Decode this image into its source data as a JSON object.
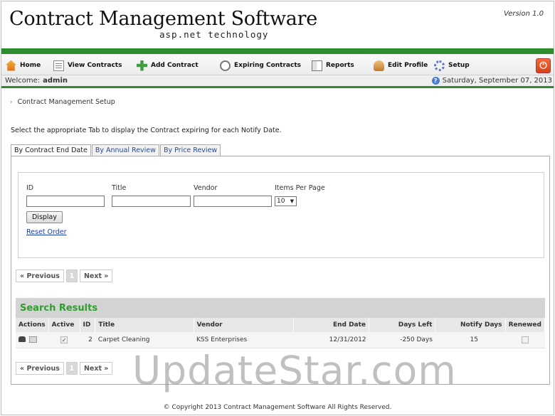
{
  "header": {
    "title": "Contract Management Software",
    "subtitle": "asp.net technology",
    "version": "Version 1.0"
  },
  "nav": {
    "items": [
      {
        "label": "Home",
        "icon": "home-icon"
      },
      {
        "label": "View Contracts",
        "icon": "view-contracts-icon"
      },
      {
        "label": "Add Contract",
        "icon": "add-contract-icon"
      },
      {
        "label": "Expiring Contracts",
        "icon": "expiring-contracts-icon"
      },
      {
        "label": "Reports",
        "icon": "reports-icon"
      },
      {
        "label": "Edit Profile",
        "icon": "edit-profile-icon"
      },
      {
        "label": "Setup",
        "icon": "setup-icon"
      }
    ],
    "logout_icon": "power-icon",
    "logout_glyph": "⏻"
  },
  "welcome": {
    "label": "Welcome:",
    "user": "admin",
    "date": "Saturday, September 07, 2013",
    "help_glyph": "?"
  },
  "breadcrumb": {
    "arrow": "›",
    "label": "Contract Management Setup"
  },
  "instructions": "Select the appropriate Tab to display the Contract expiring for each Notify Date.",
  "tabs": [
    {
      "label": "By Contract End Date",
      "active": true
    },
    {
      "label": "By Annual Review",
      "active": false
    },
    {
      "label": "By Price Review",
      "active": false
    }
  ],
  "filter": {
    "id_label": "ID",
    "title_label": "Title",
    "vendor_label": "Vendor",
    "items_per_page_label": "Items Per Page",
    "id_value": "",
    "title_value": "",
    "vendor_value": "",
    "items_per_page_value": "10",
    "display_button": "Display",
    "reset_link": "Reset Order"
  },
  "pager": {
    "previous": "« Previous",
    "current": "1",
    "next": "Next »"
  },
  "results": {
    "title": "Search Results",
    "columns": [
      "Actions",
      "Active",
      "ID",
      "Title",
      "Vendor",
      "End Date",
      "Days Left",
      "Notify Days",
      "Renewed"
    ],
    "rows": [
      {
        "active": true,
        "id": "2",
        "title": "Carpet Cleaning",
        "vendor": "KSS Enterprises",
        "end_date": "12/31/2012",
        "days_left": "-250 Days",
        "notify_days": "15",
        "renewed": false
      }
    ]
  },
  "watermark": "UpdateStar.com",
  "footer": "© Copyright 2013 Contract Management Software All Rights Reserved.",
  "colors": {
    "accent_green": "#2e8b2e",
    "results_title_green": "#2f9e2f",
    "link_blue": "#1a3fa6",
    "logout_red": "#d4401a"
  }
}
